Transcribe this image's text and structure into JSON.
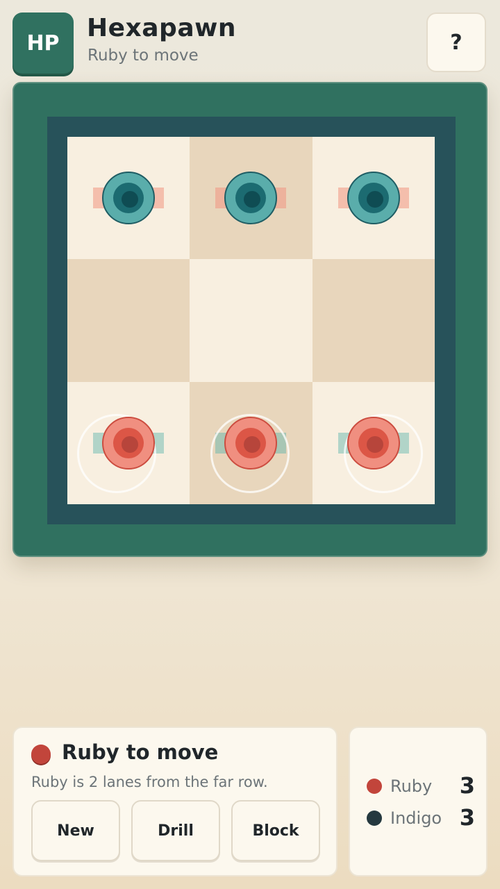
{
  "header": {
    "logo": "HP",
    "title": "Hexapawn",
    "subtitle": "Ruby to move",
    "help_label": "?"
  },
  "board": {
    "rows": [
      [
        "indigo",
        "indigo",
        "indigo"
      ],
      [
        "",
        "",
        ""
      ],
      [
        "ruby",
        "ruby",
        "ruby"
      ]
    ],
    "selectable": [
      "a1",
      "b1",
      "c1"
    ]
  },
  "status": {
    "title": "Ruby to move",
    "description": "Ruby is 2 lanes from the far row.",
    "buttons": [
      "New",
      "Drill",
      "Block"
    ]
  },
  "score": [
    {
      "label": "Ruby",
      "value": "3",
      "color": "#c2453b"
    },
    {
      "label": "Indigo",
      "value": "3",
      "color": "#25393f"
    }
  ],
  "colors": {
    "board_frame": "#307160",
    "ruby": "#dc5646",
    "indigo": "#1c6b71"
  }
}
